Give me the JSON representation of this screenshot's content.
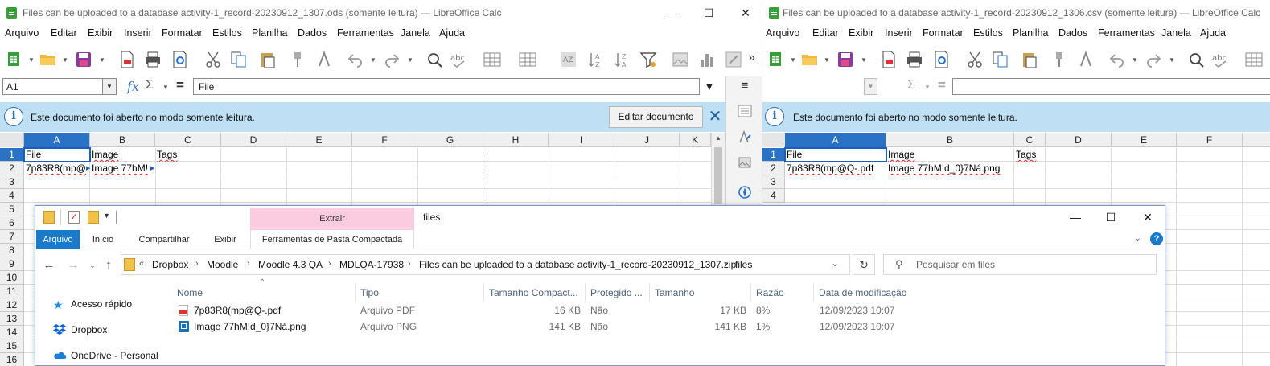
{
  "left_window": {
    "title": "Files can be uploaded to a database activity-1_record-20230912_1307.ods (somente leitura) — LibreOffice Calc",
    "menu": [
      "Arquivo",
      "Editar",
      "Exibir",
      "Inserir",
      "Formatar",
      "Estilos",
      "Planilha",
      "Dados",
      "Ferramentas",
      "Janela",
      "Ajuda"
    ],
    "name_box": "A1",
    "formula_value": "File",
    "info_text": "Este documento foi aberto no modo somente leitura.",
    "edit_button": "Editar documento",
    "columns": [
      "A",
      "B",
      "C",
      "D",
      "E",
      "F",
      "G",
      "H",
      "I",
      "J",
      "K"
    ],
    "rows": [
      "1",
      "2",
      "3",
      "4",
      "5",
      "6",
      "7",
      "8",
      "9",
      "10",
      "11",
      "12",
      "13",
      "14",
      "15",
      "16"
    ],
    "cells": {
      "a1": "File",
      "b1": "Image",
      "c1": "Tags",
      "a2": "7p83R8(mp@",
      "b2": "Image 77hM!"
    }
  },
  "right_window": {
    "title": "Files can be uploaded to a database activity-1_record-20230912_1306.csv (somente leitura) — LibreOffice Calc",
    "menu": [
      "Arquivo",
      "Editar",
      "Exibir",
      "Inserir",
      "Formatar",
      "Estilos",
      "Planilha",
      "Dados",
      "Ferramentas",
      "Janela",
      "Ajuda"
    ],
    "info_text": "Este documento foi aberto no modo somente leitura.",
    "columns": [
      "A",
      "B",
      "C",
      "D",
      "E",
      "F"
    ],
    "rows": [
      "1",
      "2",
      "3",
      "4"
    ],
    "cells": {
      "a1": "File",
      "b1": "Image",
      "c1": "Tags",
      "a2": "7p83R8(mp@Q-.pdf",
      "b2": "Image 77hM!d_0}7Ná.png"
    }
  },
  "explorer": {
    "window_title": "files",
    "extrair": "Extrair",
    "tabs": {
      "arquivo": "Arquivo",
      "inicio": "Início",
      "compartilhar": "Compartilhar",
      "exibir": "Exibir",
      "ferramentas": "Ferramentas de Pasta Compactada"
    },
    "breadcrumb": [
      "Dropbox",
      "Moodle",
      "Moodle 4.3 QA",
      "MDLQA-17938",
      "Files can be uploaded to a database activity-1_record-20230912_1307.zip",
      "files"
    ],
    "search_placeholder": "Pesquisar em files",
    "nav": [
      "Acesso rápido",
      "Dropbox",
      "OneDrive - Personal"
    ],
    "columns": [
      "Nome",
      "Tipo",
      "Tamanho Compact...",
      "Protegido ...",
      "Tamanho",
      "Razão",
      "Data de modificação"
    ],
    "files": [
      {
        "name": "7p83R8(mp@Q-.pdf",
        "type": "Arquivo PDF",
        "packed": "16 KB",
        "protected": "Não",
        "size": "17 KB",
        "ratio": "8%",
        "date": "12/09/2023 10:07"
      },
      {
        "name": "Image 77hM!d_0}7Ná.png",
        "type": "Arquivo PNG",
        "packed": "141 KB",
        "protected": "Não",
        "size": "141 KB",
        "ratio": "1%",
        "date": "12/09/2023 10:07"
      }
    ]
  },
  "colors": {
    "accent": "#2a72c6",
    "infobar": "#bfe0f4",
    "extrair": "#fbcbe0",
    "file_tab": "#1979ca"
  }
}
